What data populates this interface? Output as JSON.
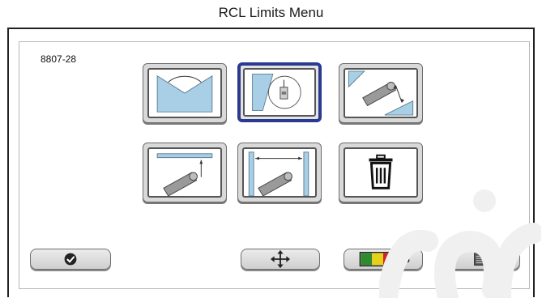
{
  "header": {
    "title": "RCL Limits Menu"
  },
  "figure_id": "8807-28",
  "menu_tiles": [
    {
      "icon": "boom-swing-sector-limit-icon",
      "selected": false
    },
    {
      "icon": "virtual-wall-plan-view-icon",
      "selected": true
    },
    {
      "icon": "boom-angle-limit-icon",
      "selected": false
    },
    {
      "icon": "tip-height-limit-icon",
      "selected": false
    },
    {
      "icon": "operating-radius-limit-icon",
      "selected": false
    },
    {
      "icon": "trash-icon",
      "selected": false
    }
  ],
  "bottom_buttons": [
    {
      "icon": "checkmark-icon"
    },
    {
      "icon": "move-arrows-icon"
    },
    {
      "icon": "load-percent-bar-icon",
      "label": "%",
      "colors": [
        "#2e8b2e",
        "#e6d11a",
        "#d42020"
      ]
    },
    {
      "icon": "menu-list-icon"
    }
  ],
  "colors": {
    "selected_border": "#2b3a8f",
    "icon_fill": "#a9cfe6",
    "icon_grey": "#8a8a8a"
  }
}
